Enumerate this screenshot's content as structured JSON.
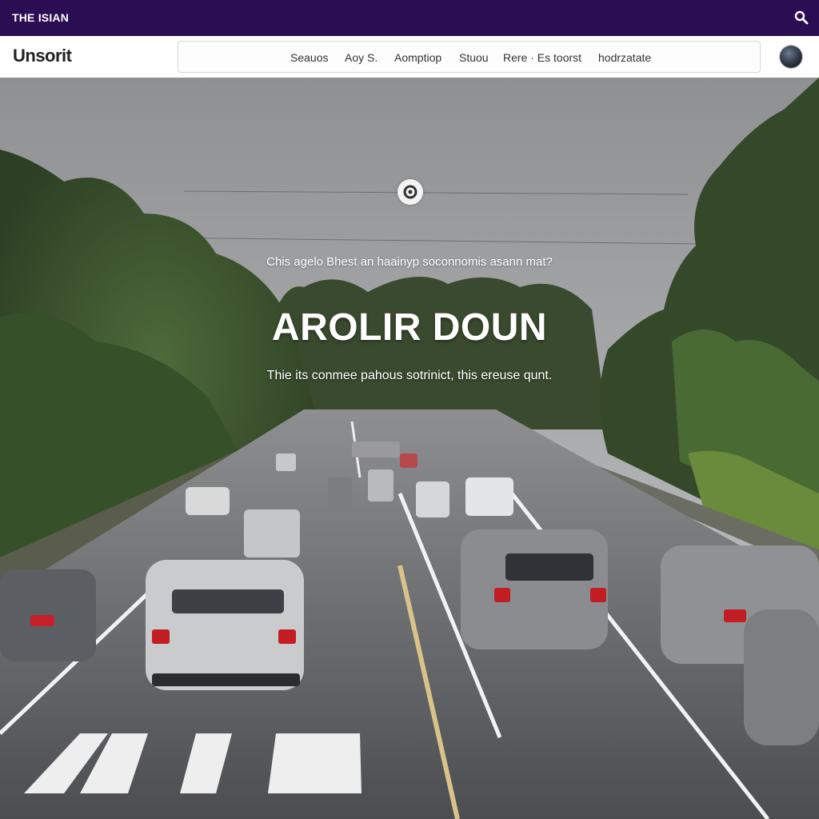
{
  "topbar": {
    "brand": "THE ISIAN",
    "search_icon": "search-icon"
  },
  "navbar": {
    "logo": "Unsorit",
    "items": [
      {
        "label": "Seauos"
      },
      {
        "label": "Aoy S."
      },
      {
        "label": "Aomptiop"
      },
      {
        "label": "Stuou"
      },
      {
        "label": "Rere · Es toorst"
      },
      {
        "label": "hodrzatate"
      }
    ],
    "globe_icon": "globe-icon"
  },
  "hero": {
    "pretitle": "Chis agelo Bhest an haainyp soconnomis asann mat?",
    "title": "AROLIR DOUN",
    "subtitle": "Thie its conmee pahous sotrinict,  this ereuse qunt.",
    "center_icon": "location-icon"
  },
  "colors": {
    "topbar_bg": "#2a0d52",
    "navbar_bg": "#ffffff",
    "hero_text": "#ffffff"
  }
}
